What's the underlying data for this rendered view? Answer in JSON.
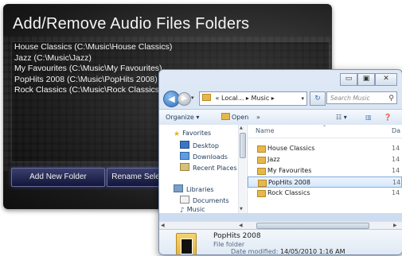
{
  "media_panel": {
    "title": "Add/Remove Audio Files Folders",
    "folders": [
      "House Classics  (C:\\Music\\House Classics)",
      "Jazz  (C:\\Music\\Jazz)",
      "My Favourites  (C:\\Music\\My Favourites)",
      "PopHits 2008  (C:\\Music\\PopHits 2008)",
      "Rock Classics  (C:\\Music\\Rock Classics)"
    ],
    "add_button": "Add New Folder",
    "rename_button": "Rename Selected"
  },
  "explorer": {
    "address": {
      "prefix": "«",
      "part1": "Local...",
      "sep": "▸",
      "part2": "Music",
      "sep2": "▸"
    },
    "search_placeholder": "Search Music",
    "toolbar": {
      "organize": "Organize ▾",
      "open": "Open",
      "more": "»",
      "views": "☷ ▾"
    },
    "nav": {
      "favorites": "Favorites",
      "desktop": "Desktop",
      "downloads": "Downloads",
      "recent": "Recent Places",
      "libraries": "Libraries",
      "documents": "Documents",
      "music": "Music"
    },
    "columns": {
      "name": "Name",
      "date": "Da"
    },
    "files": [
      {
        "name": "House Classics",
        "date": "14"
      },
      {
        "name": "Jazz",
        "date": "14"
      },
      {
        "name": "My Favourites",
        "date": "14"
      },
      {
        "name": "PopHits 2008",
        "date": "14",
        "selected": true
      },
      {
        "name": "Rock Classics",
        "date": "14"
      }
    ],
    "details": {
      "name": "PopHits 2008",
      "type": "File folder",
      "modified_label": "Date modified:",
      "modified_value": "14/05/2010 1:16 AM"
    }
  },
  "colors": {
    "selection": "#d6e8fb",
    "folder": "#e6b84b",
    "dark_button": "#2a2f5a"
  }
}
